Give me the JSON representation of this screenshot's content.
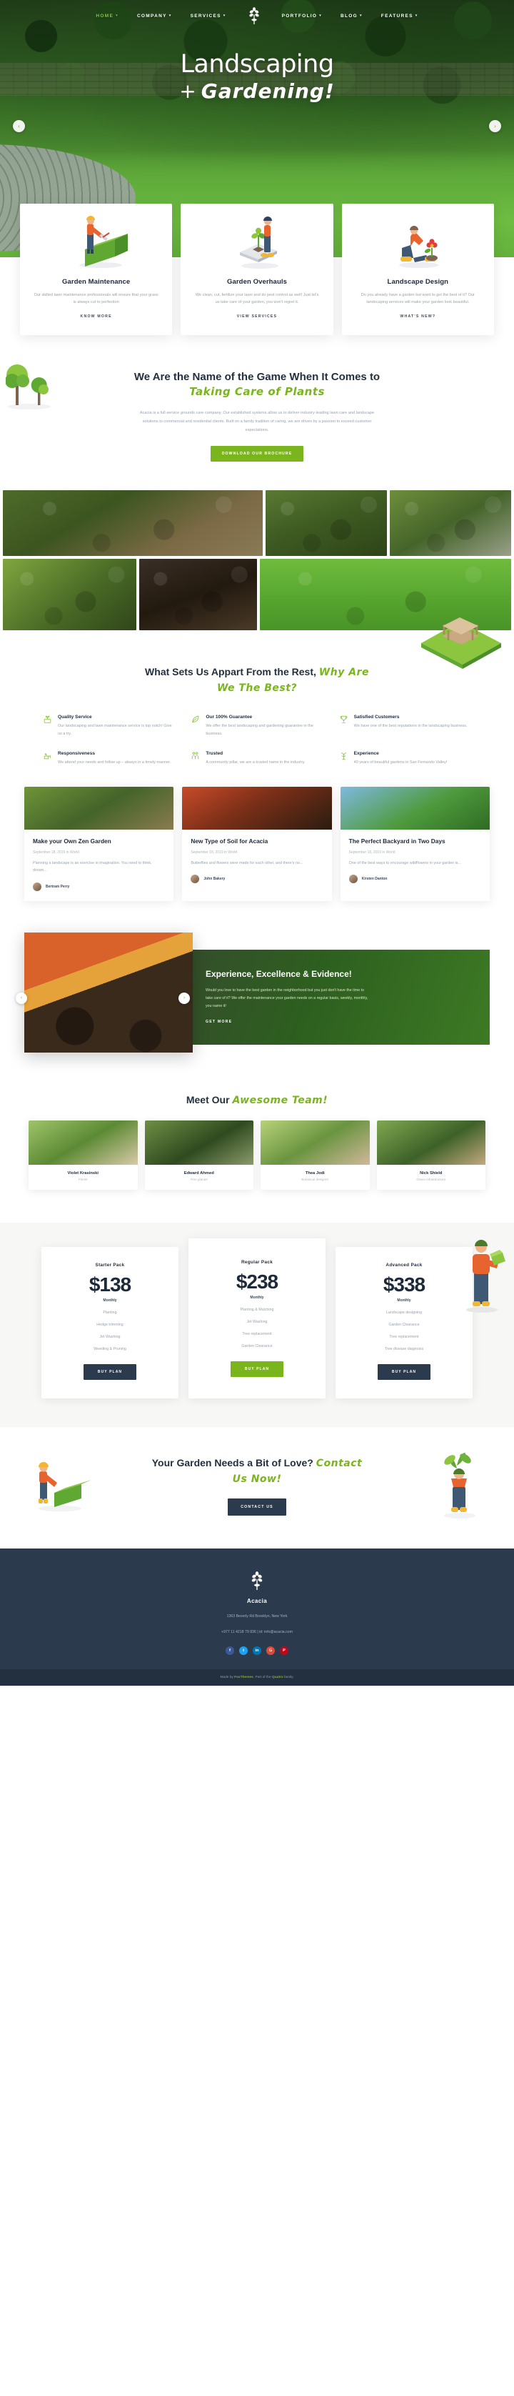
{
  "nav": {
    "items": [
      {
        "label": "HOME",
        "caret": "▾",
        "active": true
      },
      {
        "label": "COMPANY",
        "caret": "▾",
        "active": false
      },
      {
        "label": "SERVICES",
        "caret": "▾",
        "active": false
      },
      {
        "label": "PORTFOLIO",
        "caret": "▾",
        "active": false
      },
      {
        "label": "BLOG",
        "caret": "▾",
        "active": false
      },
      {
        "label": "FEATURES",
        "caret": "▾",
        "active": false
      }
    ]
  },
  "hero": {
    "title_line1": "Landscaping",
    "title_plus": "+",
    "title_line2": "Gardening!",
    "prev_arrow": "‹",
    "next_arrow": "›"
  },
  "services": [
    {
      "title": "Garden Maintenance",
      "desc": "Our skilled lawn maintenance professionals will ensure that your grass is always cut to perfection",
      "button": "KNOW MORE",
      "icon": "gardener-trimming-hedge-icon"
    },
    {
      "title": "Garden Overhauls",
      "desc": "We clean, cut, fertilize your lawn and do pest control as well! Just let's us take care of your garden, you won't regret it.",
      "button": "VIEW SERVICES",
      "icon": "gardener-with-plant-tray-icon"
    },
    {
      "title": "Landscape Design",
      "desc": "Do you already have a garden but want to get the best of it? Our landscaping services will make your garden look beautiful.",
      "button": "WHAT'S NEW?",
      "icon": "gardener-planting-flowers-icon"
    }
  ],
  "about": {
    "heading_plain": "We Are the Name of the Game When It Comes to ",
    "heading_accent": "Taking Care of Plants",
    "paragraph": "Acacia is a full-service grounds care company. Our established systems allow us to deliver industry-leading lawn care and landscape solutions to commercial and residential clients. Built on a family tradition of caring, we are driven by a passion to exceed customer expectations.",
    "button": "DOWNLOAD OUR BROCHURE"
  },
  "gallery": {
    "row1": [
      {
        "name": "garden-bed-with-tools-photo"
      },
      {
        "name": "pond-with-plants-photo"
      },
      {
        "name": "gardener-on-rocks-photo"
      }
    ],
    "row2": [
      {
        "name": "hands-planting-photo"
      },
      {
        "name": "gloves-with-mulch-photo"
      },
      {
        "name": "manicured-lawn-photo"
      }
    ]
  },
  "features": {
    "heading_plain": "What Sets Us Appart From the Rest, ",
    "heading_accent": "Why Are We The Best?",
    "items": [
      {
        "title": "Quality Service",
        "desc": "Our landscaping and lawn maintenance service is top notch! Give us a try.",
        "icon": "plant-box-icon"
      },
      {
        "title": "Our 100% Guarantee",
        "desc": "We offer the best landscaping and gardening guarantee in the business.",
        "icon": "leaf-sprout-icon"
      },
      {
        "title": "Satisfied Customers",
        "desc": "We have one of the best reputations in the landscaping business.",
        "icon": "trophy-plant-icon"
      },
      {
        "title": "Responsiveness",
        "desc": "We attend your needs and follow up – always in a timely manner.",
        "icon": "watering-plant-icon"
      },
      {
        "title": "Trusted",
        "desc": "A community pillar, we are a trusted name in the industry.",
        "icon": "two-people-icon"
      },
      {
        "title": "Experience",
        "desc": "40 years of beautiful gardens in San Fernando Valley!",
        "icon": "tree-growth-icon"
      }
    ]
  },
  "blog": [
    {
      "title": "Make your Own Zen Garden",
      "meta": "September 18, 2019 in World",
      "excerpt": "Planning a landscape is an exercise in imagination. You need to think, dream...",
      "author": "Bertram Perry",
      "image": "zen-garden-photo"
    },
    {
      "title": "New Type of Soil for Acacia",
      "meta": "September 18, 2019 in World",
      "excerpt": "Butterflies and flowers were made for each other, and there's no...",
      "author": "John Bakery",
      "image": "dark-mulch-photo"
    },
    {
      "title": "The Perfect Backyard in Two Days",
      "meta": "September 18, 2019 in World",
      "excerpt": "One of the best ways to encourage wildflowers in your garden is...",
      "author": "Kirsten Danton",
      "image": "backyard-house-photo"
    }
  ],
  "experience": {
    "title": "Experience, Excellence & Evidence!",
    "paragraph": "Would you love to have the best garden in the neighborhood but you just don't have the time to take care of it? We offer the maintenance your garden needs on a regular basis, weekly, monthly, you name it!",
    "button": "GET MORE",
    "prev_arrow": "‹",
    "next_arrow": "›",
    "image": "gloved-hands-in-mulch-photo"
  },
  "team": {
    "heading_plain": "Meet Our ",
    "heading_accent": "Awesome Team!",
    "members": [
      {
        "name": "Violet Krasinski",
        "role": "Florist",
        "photo": "woman-with-plants-photo"
      },
      {
        "name": "Edward Ahmed",
        "role": "Tree planter",
        "photo": "man-planting-tree-photo"
      },
      {
        "name": "Thea Jodi",
        "role": "Botanical designer",
        "photo": "woman-in-garden-photo"
      },
      {
        "name": "Nick Shield",
        "role": "Green infrastructure",
        "photo": "man-with-plant-crate-photo"
      }
    ]
  },
  "pricing": [
    {
      "name": "Starter Pack",
      "price": "$138",
      "period": "Monthly",
      "features": [
        "Planting",
        "Hedge trimming",
        "Jet Washing",
        "Weeding & Pruning"
      ],
      "button": "BUY PLAN",
      "featured": false
    },
    {
      "name": "Regular Pack",
      "price": "$238",
      "period": "Monthly",
      "features": [
        "Planting & Mulching",
        "Jet Washing",
        "Tree replacement",
        "Garden Clearance"
      ],
      "button": "BUY PLAN",
      "featured": true
    },
    {
      "name": "Advanced Pack",
      "price": "$338",
      "period": "Monthly",
      "features": [
        "Landscape designing",
        "Garden Clearance",
        "Tree replacement",
        "Tree disease diagnosis"
      ],
      "button": "BUY PLAN",
      "featured": false
    }
  ],
  "cta": {
    "heading_plain": "Your Garden Needs a Bit of Love? ",
    "heading_accent": "Contact Us Now!",
    "button": "CONTACT US"
  },
  "footer": {
    "brand": "Acacia",
    "address": "1363 Beverly Rd Brooklyn, New York",
    "contact": "+977 11 4218 79 836 | id: info@acacia.com",
    "social": [
      {
        "glyph": "f",
        "name": "facebook-icon",
        "color": "#3b5998"
      },
      {
        "glyph": "t",
        "name": "twitter-icon",
        "color": "#1da1f2"
      },
      {
        "glyph": "in",
        "name": "linkedin-icon",
        "color": "#0077b5"
      },
      {
        "glyph": "G",
        "name": "google-plus-icon",
        "color": "#dd4b39"
      },
      {
        "glyph": "P",
        "name": "pinterest-icon",
        "color": "#bd081c"
      }
    ],
    "copyright_pre": "Made by ",
    "copyright_brand1": "FoxThemes",
    "copyright_mid": ". Part of the ",
    "copyright_brand2": "Quatro",
    "copyright_post": " family."
  },
  "colors": {
    "accent_green": "#7ab51d",
    "dark_navy": "#2b3a4c",
    "muted_text": "#9aa3ae"
  }
}
